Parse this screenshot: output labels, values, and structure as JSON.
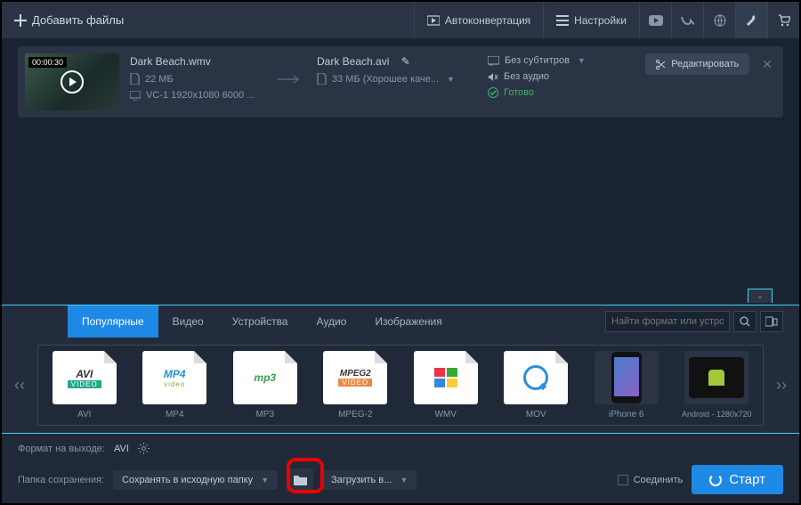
{
  "header": {
    "add_files": "Добавить файлы",
    "autoconvert": "Автоконвертация",
    "settings": "Настройки"
  },
  "file": {
    "duration": "00:00:30",
    "name": "Dark Beach.wmv",
    "size": "22 МБ",
    "codec": "VC-1 1920x1080 6000 ...",
    "out_name": "Dark Beach.avi",
    "out_size_quality": "33 МБ (Хорошее каче...",
    "subtitles": "Без субтитров",
    "audio": "Без аудио",
    "status": "Готово",
    "edit": "Редактировать"
  },
  "tabs": {
    "popular": "Популярные",
    "video": "Видео",
    "devices": "Устройства",
    "audio": "Аудио",
    "images": "Изображения",
    "search_placeholder": "Найти формат или устрой..."
  },
  "formats": [
    {
      "logo": "AVI",
      "sub": "VIDEO",
      "label": "AVI"
    },
    {
      "logo": "MP4",
      "sub": "video",
      "label": "MP4"
    },
    {
      "logo": "mp3",
      "sub": "",
      "label": "MP3"
    },
    {
      "logo": "MPEG2",
      "sub": "VIDEO",
      "label": "MPEG-2"
    },
    {
      "logo": "",
      "sub": "",
      "label": "WMV"
    },
    {
      "logo": "",
      "sub": "",
      "label": "MOV"
    },
    {
      "logo": "",
      "sub": "",
      "label": "iPhone 6"
    },
    {
      "logo": "",
      "sub": "",
      "label": "Android - 1280x720"
    }
  ],
  "bottom": {
    "output_format_label": "Формат на выходе:",
    "output_format_value": "AVI",
    "save_folder_label": "Папка сохранения:",
    "save_folder_value": "Сохранять в исходную папку",
    "upload_to": "Загрузить в...",
    "merge": "Соединить",
    "start": "Старт"
  }
}
